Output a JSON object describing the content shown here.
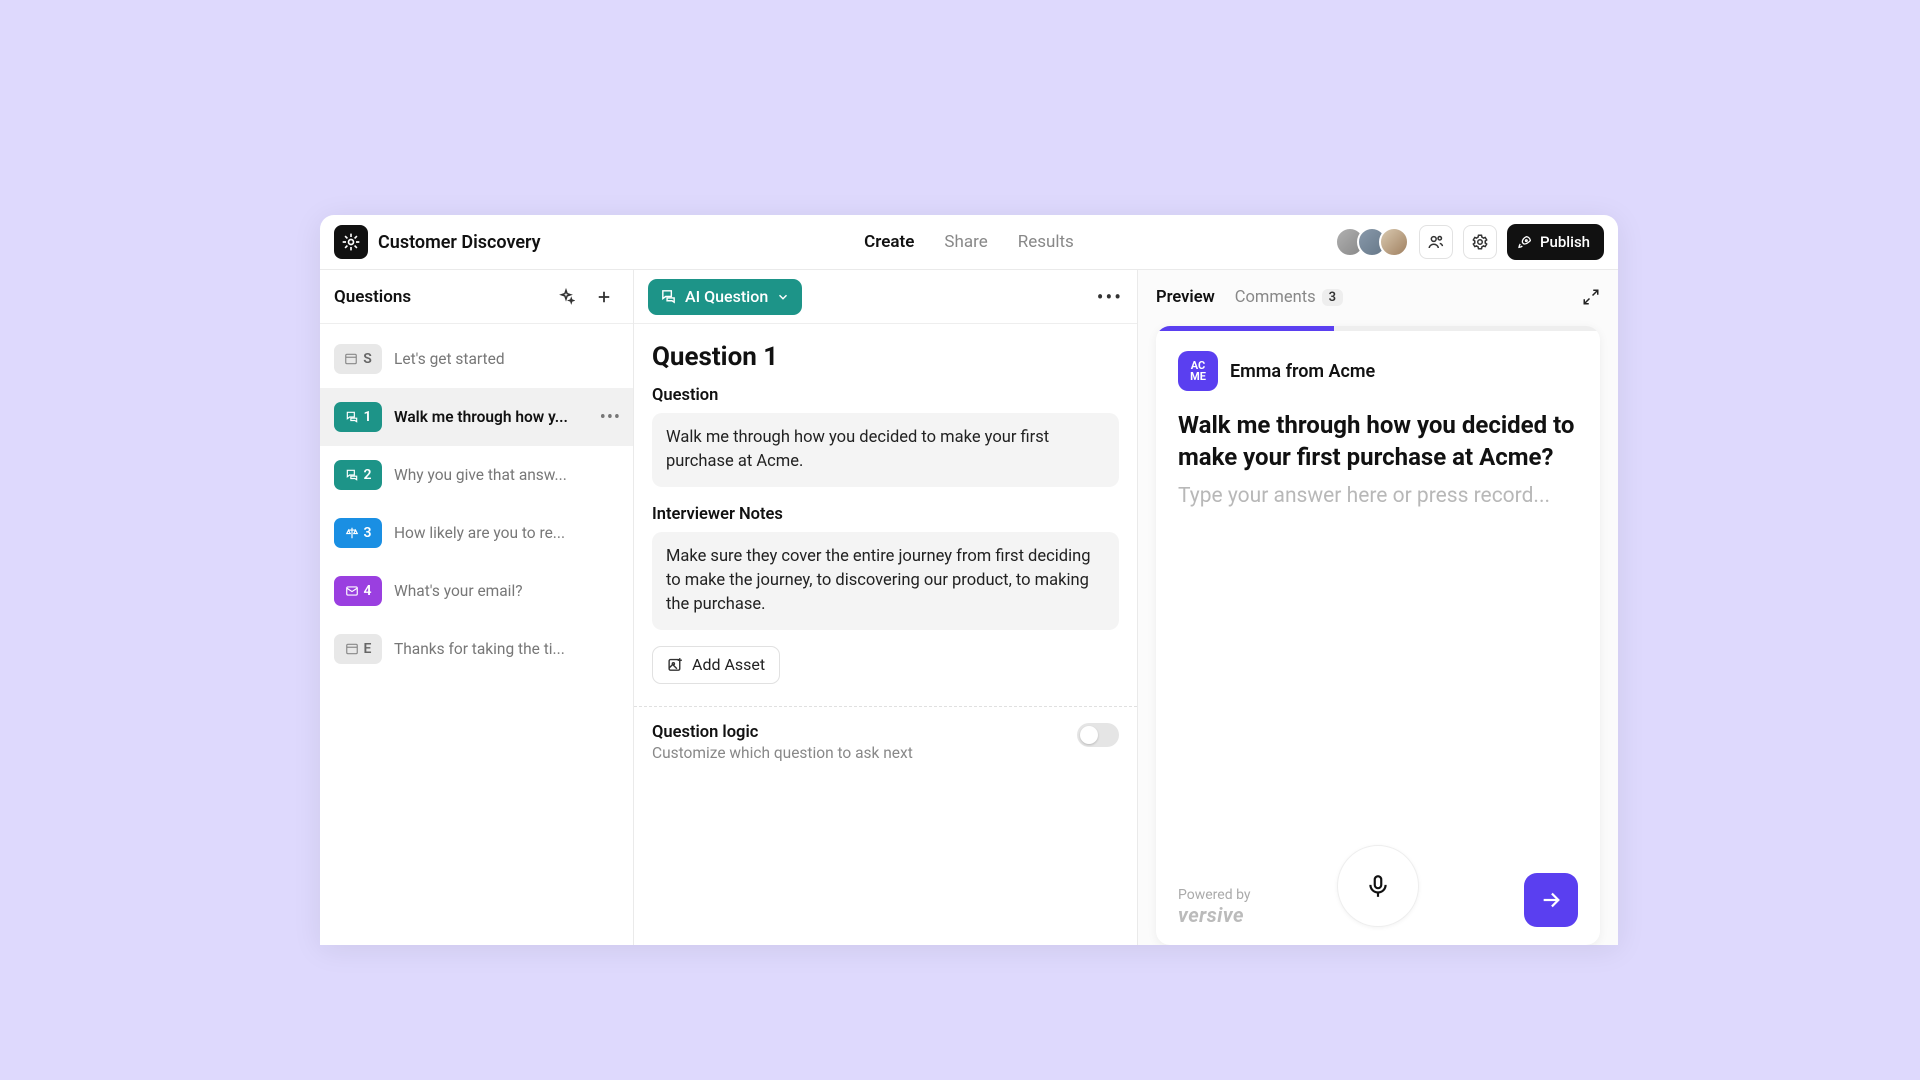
{
  "header": {
    "title": "Customer Discovery",
    "tabs": {
      "create": "Create",
      "share": "Share",
      "results": "Results"
    },
    "publish": "Publish"
  },
  "sidebar": {
    "title": "Questions",
    "items": [
      {
        "badge": "S",
        "label": "Let's get started"
      },
      {
        "badge": "1",
        "label": "Walk me through how y..."
      },
      {
        "badge": "2",
        "label": "Why you give that answ..."
      },
      {
        "badge": "3",
        "label": "How likely are you to re..."
      },
      {
        "badge": "4",
        "label": "What's your email?"
      },
      {
        "badge": "E",
        "label": "Thanks for taking the ti..."
      }
    ]
  },
  "editor": {
    "type_label": "AI Question",
    "title": "Question 1",
    "question_label": "Question",
    "question_text": "Walk me through how you decided to make your first purchase at Acme.",
    "notes_label": "Interviewer Notes",
    "notes_text": "Make sure they cover the entire journey from first deciding to make the journey, to discovering our product, to making the purchase.",
    "add_asset": "Add Asset",
    "logic_title": "Question logic",
    "logic_sub": "Customize which question to ask next"
  },
  "preview": {
    "tab_preview": "Preview",
    "tab_comments": "Comments",
    "comments_count": "3",
    "persona_logo": {
      "l1": "AC",
      "l2": "ME"
    },
    "persona_name": "Emma from Acme",
    "question": "Walk me through how you decided to make your first purchase at Acme?",
    "placeholder": "Type your answer here or press record...",
    "powered_by": "Powered by",
    "brand": "versive"
  },
  "colors": {
    "teal": "#1d9488",
    "accent": "#5a3ff0"
  }
}
